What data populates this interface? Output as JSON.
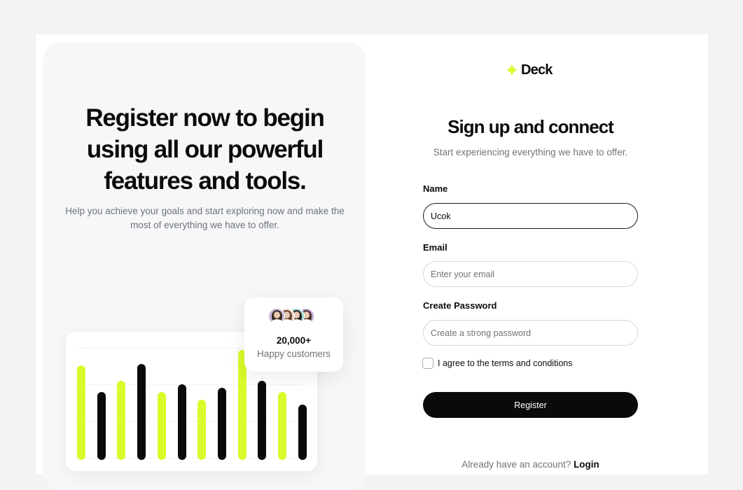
{
  "hero": {
    "title": "Register now to begin using all our powerful features and tools.",
    "subtitle": "Help you achieve your goals and start exploring now and make the most of everything we have to offer."
  },
  "chart": {
    "bars": [
      {
        "value": 0.75,
        "color": "#d9fa2b"
      },
      {
        "value": 0.54,
        "color": "#0a0a0a"
      },
      {
        "value": 0.63,
        "color": "#d9fa2b"
      },
      {
        "value": 0.76,
        "color": "#0a0a0a"
      },
      {
        "value": 0.54,
        "color": "#d9fa2b"
      },
      {
        "value": 0.6,
        "color": "#0a0a0a"
      },
      {
        "value": 0.48,
        "color": "#d9fa2b"
      },
      {
        "value": 0.57,
        "color": "#0a0a0a"
      },
      {
        "value": 0.87,
        "color": "#d9fa2b"
      },
      {
        "value": 0.63,
        "color": "#0a0a0a"
      },
      {
        "value": 0.54,
        "color": "#d9fa2b"
      },
      {
        "value": 0.44,
        "color": "#0a0a0a"
      }
    ]
  },
  "customers": {
    "count": "20,000+",
    "label": "Happy customers",
    "avatars": [
      {
        "bg": "#c8b7d9",
        "hair": "#3b2a22"
      },
      {
        "bg": "#f0d9c8",
        "hair": "#6b4530"
      },
      {
        "bg": "#9fd8dc",
        "hair": "#2d1f1a"
      },
      {
        "bg": "#bda7d6",
        "hair": "#4a3226"
      }
    ]
  },
  "brand": {
    "name": "Deck",
    "accent": "#d9fa2b",
    "logo_icon": "sparkle-icon"
  },
  "form": {
    "title": "Sign up and connect",
    "subtitle": "Start experiencing everything we have to offer.",
    "name_label": "Name",
    "name_value": "Ucok",
    "email_label": "Email",
    "email_placeholder": "Enter your email",
    "password_label": "Create Password",
    "password_placeholder": "Create a strong password",
    "terms_label": "I agree to the terms and conditions",
    "register_label": "Register",
    "account_prompt": "Already have an account?",
    "login_label": "Login"
  }
}
